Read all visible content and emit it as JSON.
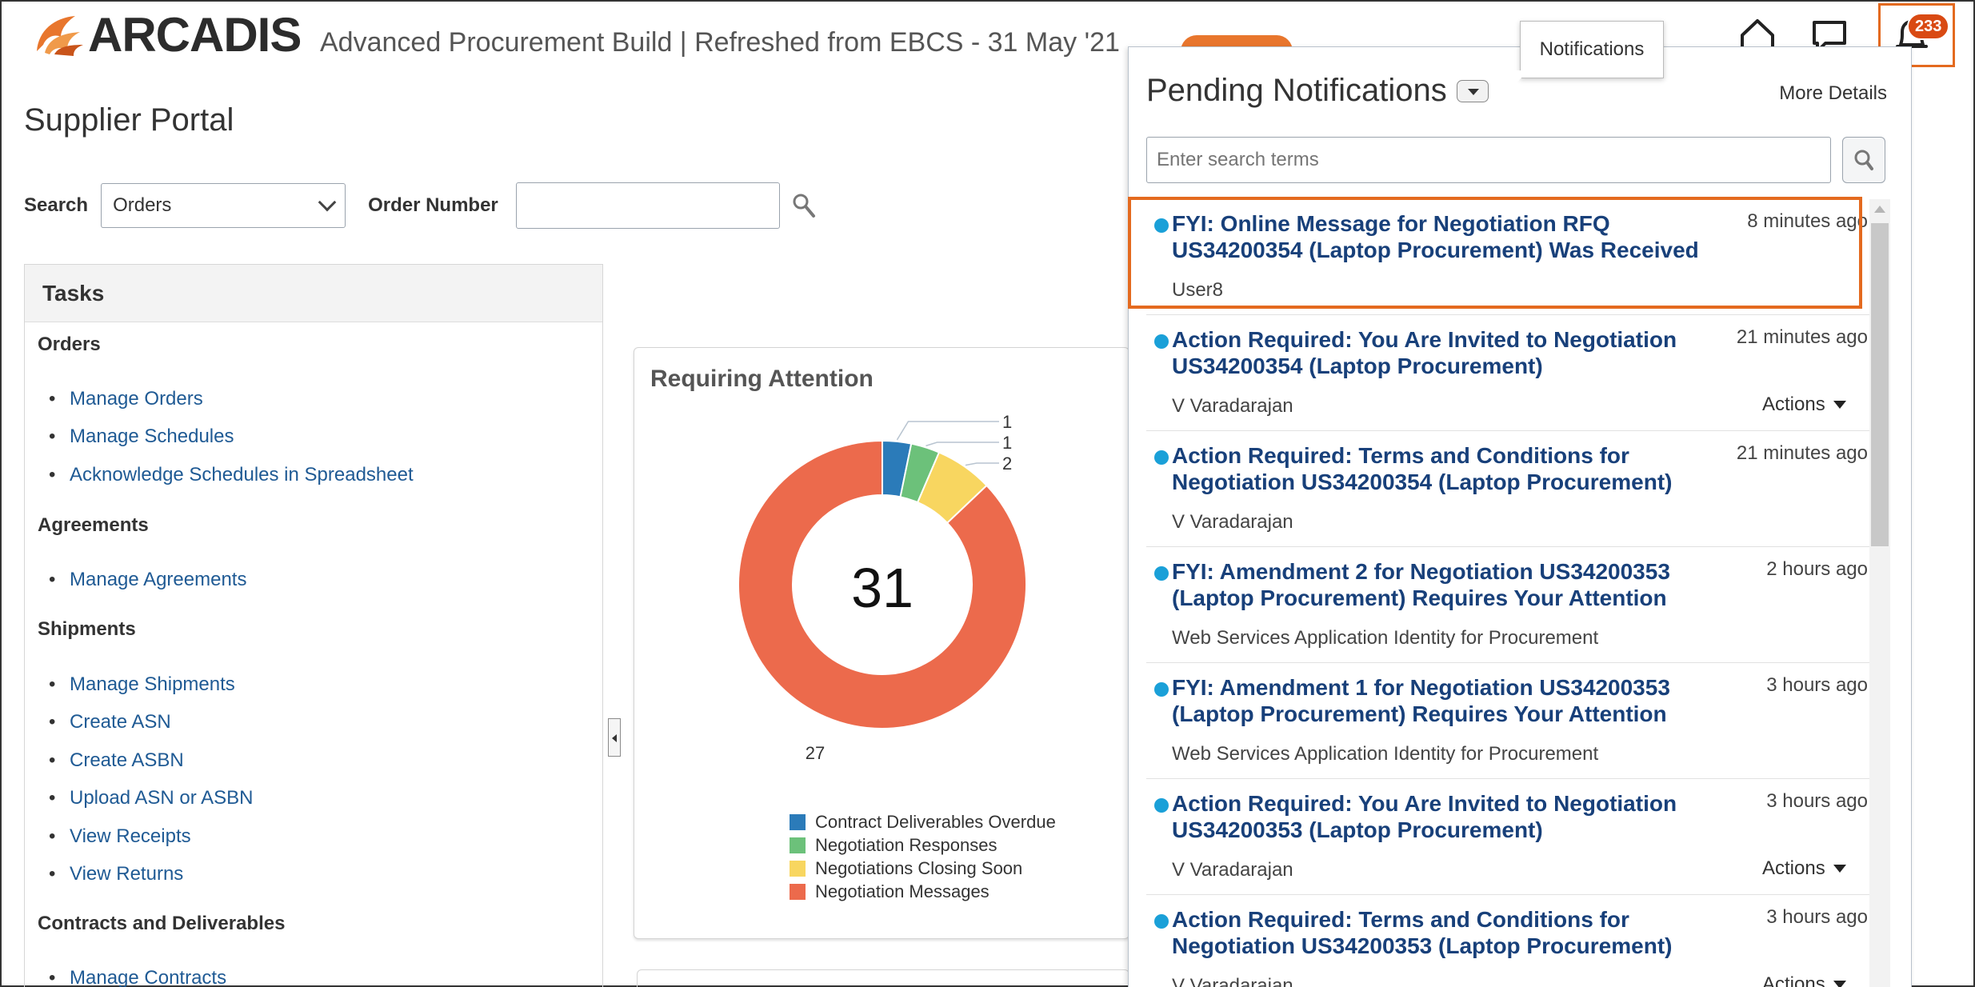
{
  "header": {
    "logo_text": "ARCADIS",
    "subtitle": "Advanced Procurement Build | Refreshed from EBCS - 31 May '21",
    "page_title": "Supplier Portal",
    "icons": [
      "home-icon",
      "chat-icon",
      "bell-icon"
    ],
    "notification_count": "233",
    "tooltip": "Notifications"
  },
  "search": {
    "label": "Search",
    "selected": "Orders",
    "order_number_label": "Order Number",
    "order_number_value": ""
  },
  "tasks": {
    "title": "Tasks",
    "sections": [
      {
        "name": "Orders",
        "links": [
          "Manage Orders",
          "Manage Schedules",
          "Acknowledge Schedules in Spreadsheet"
        ]
      },
      {
        "name": "Agreements",
        "links": [
          "Manage Agreements"
        ]
      },
      {
        "name": "Shipments",
        "links": [
          "Manage Shipments",
          "Create ASN",
          "Create ASBN",
          "Upload ASN or ASBN",
          "View Receipts",
          "View Returns"
        ]
      },
      {
        "name": "Contracts and Deliverables",
        "links": [
          "Manage Contracts"
        ]
      }
    ]
  },
  "requiring_attention": {
    "title": "Requiring Attention",
    "total": "31"
  },
  "chart_data": {
    "type": "pie",
    "title": "Requiring Attention",
    "center_label": "31",
    "categories": [
      "Contract Deliverables Overdue",
      "Negotiation Responses",
      "Negotiations Closing Soon",
      "Negotiation Messages"
    ],
    "values": [
      1,
      1,
      2,
      27
    ],
    "colors": [
      "#2b7bb9",
      "#6cc17a",
      "#f8d660",
      "#ec6a4c"
    ],
    "legend_position": "bottom"
  },
  "notifications": {
    "title": "Pending Notifications",
    "more_details": "More Details",
    "search_placeholder": "Enter search terms",
    "actions_label": "Actions",
    "items": [
      {
        "title": "FYI: Online Message for Negotiation RFQ US34200354 (Laptop Procurement) Was Received",
        "time": "8 minutes ago",
        "sender": "User8",
        "has_actions": false
      },
      {
        "title": "Action Required: You Are Invited to Negotiation US34200354 (Laptop Procurement)",
        "time": "21 minutes ago",
        "sender": "V Varadarajan",
        "has_actions": true
      },
      {
        "title": "Action Required: Terms and Conditions for Negotiation US34200354 (Laptop Procurement)",
        "time": "21 minutes ago",
        "sender": "V Varadarajan",
        "has_actions": false
      },
      {
        "title": "FYI: Amendment 2 for Negotiation US34200353 (Laptop Procurement) Requires Your Attention",
        "time": "2 hours ago",
        "sender": "Web Services Application Identity for Procurement",
        "has_actions": false
      },
      {
        "title": "FYI: Amendment 1 for Negotiation US34200353 (Laptop Procurement) Requires Your Attention",
        "time": "3 hours ago",
        "sender": "Web Services Application Identity for Procurement",
        "has_actions": false
      },
      {
        "title": "Action Required: You Are Invited to Negotiation US34200353 (Laptop Procurement)",
        "time": "3 hours ago",
        "sender": "V Varadarajan",
        "has_actions": true
      },
      {
        "title": "Action Required: Terms and Conditions for Negotiation US34200353 (Laptop Procurement)",
        "time": "3 hours ago",
        "sender": "V Varadarajan",
        "has_actions": true
      }
    ]
  }
}
